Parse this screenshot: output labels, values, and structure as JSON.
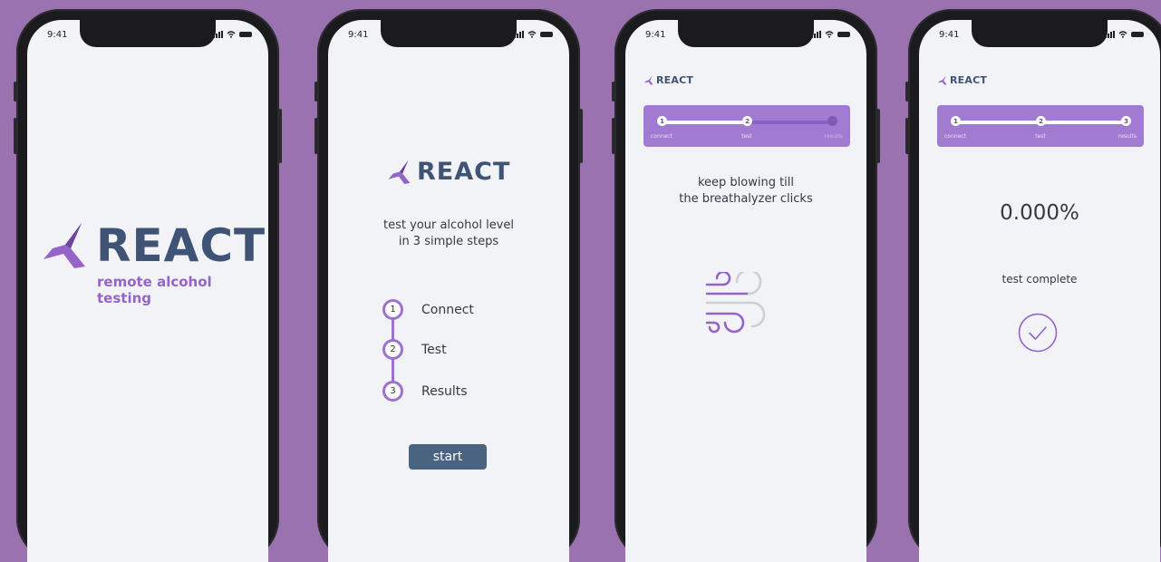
{
  "colors": {
    "background": "#9b72b0",
    "brand_purple": "#9464c8",
    "brand_navy": "#3f5374",
    "button": "#4a6380"
  },
  "status_bar": {
    "time": "9:41"
  },
  "screen1": {
    "logo_text": "REACT",
    "tagline": "remote alcohol testing"
  },
  "screen2": {
    "logo_text": "REACT",
    "intro": "test your alcohol level in 3 simple steps",
    "steps": [
      {
        "num": "1",
        "label": "Connect"
      },
      {
        "num": "2",
        "label": "Test"
      },
      {
        "num": "3",
        "label": "Results"
      }
    ],
    "start_label": "start"
  },
  "screen3": {
    "logo_text": "REACT",
    "progress": {
      "labels": [
        "connect",
        "test",
        "results"
      ],
      "nums": [
        "1",
        "2",
        "3"
      ],
      "completed_fraction": 0.5
    },
    "instruction_line1": "keep blowing till",
    "instruction_line2": "the breathalyzer clicks",
    "icon": "wind-icon"
  },
  "screen4": {
    "logo_text": "REACT",
    "progress": {
      "labels": [
        "connect",
        "test",
        "results"
      ],
      "nums": [
        "1",
        "2",
        "3"
      ],
      "completed_fraction": 1.0
    },
    "result": "0.000%",
    "status": "test complete",
    "icon": "check-circle-icon"
  }
}
